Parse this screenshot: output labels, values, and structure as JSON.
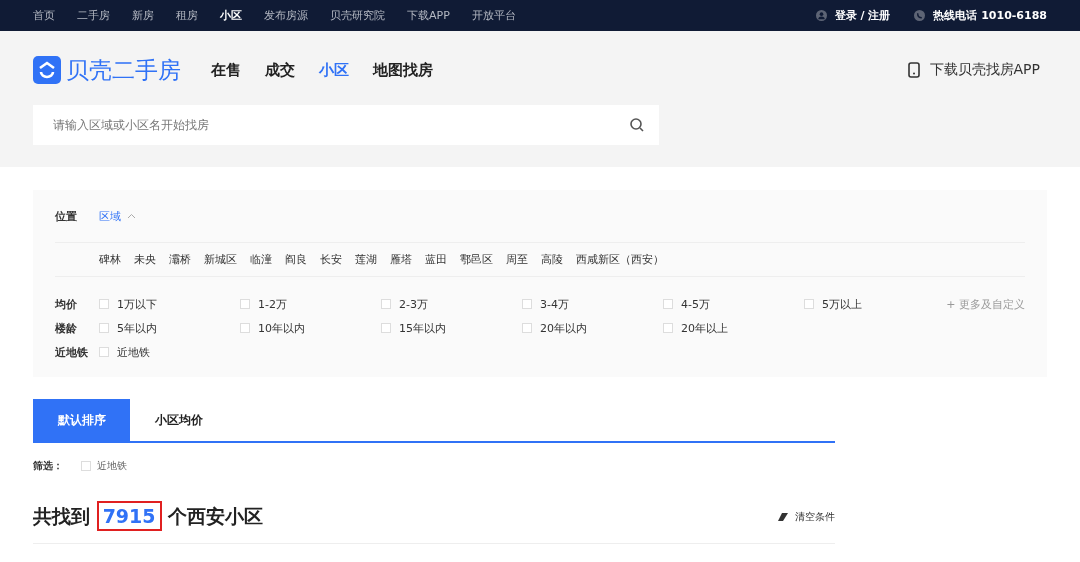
{
  "top_nav": {
    "items": [
      {
        "label": "首页",
        "selected": false
      },
      {
        "label": "二手房",
        "selected": false
      },
      {
        "label": "新房",
        "selected": false
      },
      {
        "label": "租房",
        "selected": false
      },
      {
        "label": "小区",
        "selected": true
      },
      {
        "label": "发布房源",
        "selected": false
      },
      {
        "label": "贝壳研究院",
        "selected": false
      },
      {
        "label": "下载APP",
        "selected": false
      },
      {
        "label": "开放平台",
        "selected": false
      }
    ],
    "login": "登录 / 注册",
    "hotline": "热线电话 1010-6188"
  },
  "header": {
    "logo_text": "贝壳二手房",
    "nav": [
      {
        "label": "在售",
        "selected": false
      },
      {
        "label": "成交",
        "selected": false
      },
      {
        "label": "小区",
        "selected": true
      },
      {
        "label": "地图找房",
        "selected": false
      }
    ],
    "app_download": "下载贝壳找房APP",
    "search": {
      "placeholder": "请输入区域或小区名开始找房"
    }
  },
  "filters": {
    "location": {
      "label": "位置",
      "mode": "区域",
      "expanded": true
    },
    "districts": [
      "碑林",
      "未央",
      "灞桥",
      "新城区",
      "临潼",
      "阎良",
      "长安",
      "莲湖",
      "雁塔",
      "蓝田",
      "鄠邑区",
      "周至",
      "高陵",
      "西咸新区（西安）"
    ],
    "rows": [
      {
        "label": "均价",
        "options": [
          {
            "label": "1万以下",
            "checked": false
          },
          {
            "label": "1-2万",
            "checked": false
          },
          {
            "label": "2-3万",
            "checked": false
          },
          {
            "label": "3-4万",
            "checked": false
          },
          {
            "label": "4-5万",
            "checked": false
          },
          {
            "label": "5万以上",
            "checked": false
          }
        ]
      },
      {
        "label": "楼龄",
        "options": [
          {
            "label": "5年以内",
            "checked": false
          },
          {
            "label": "10年以内",
            "checked": false
          },
          {
            "label": "15年以内",
            "checked": false
          },
          {
            "label": "20年以内",
            "checked": false
          },
          {
            "label": "20年以上",
            "checked": false
          }
        ]
      },
      {
        "label": "近地铁",
        "options": [
          {
            "label": "近地铁",
            "checked": false
          }
        ]
      }
    ],
    "more": "+ 更多及自定义"
  },
  "sort_tabs": [
    {
      "label": "默认排序",
      "selected": true
    },
    {
      "label": "小区均价",
      "selected": false
    }
  ],
  "screen": {
    "label": "筛选：",
    "options": [
      {
        "label": "近地铁",
        "checked": false
      }
    ]
  },
  "result": {
    "prefix": "共找到",
    "count": "7915",
    "suffix": "个西安小区",
    "count_highlighted": true,
    "clear": "清空条件"
  }
}
